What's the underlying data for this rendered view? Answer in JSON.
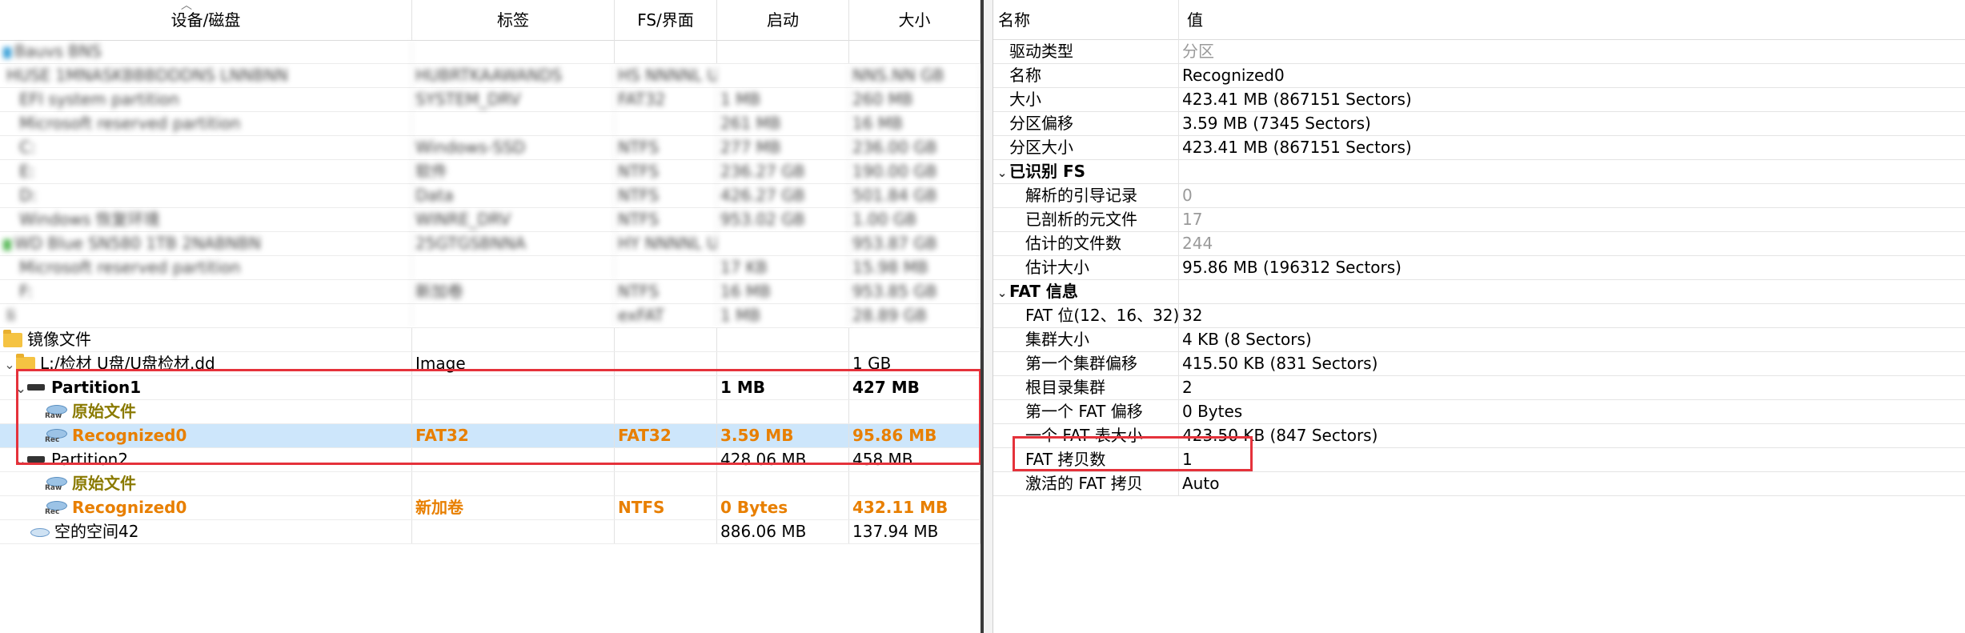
{
  "left": {
    "columns": [
      "设备/磁盘",
      "标签",
      "FS/界面",
      "启动",
      "大小"
    ],
    "blurred_rows": [
      [
        "Bauvs BNS",
        "",
        "",
        "",
        ""
      ],
      [
        "HUSE 1MNASKBBBDDDNS LNNBNN",
        "HUBRTKAAWANDS",
        "HS NNNNL UGB",
        "",
        "NNS.NN GB"
      ],
      [
        "EFI system partition",
        "SYSTEM_DRV",
        "FAT32",
        "1 MB",
        "260 MB"
      ],
      [
        "Microsoft reserved partition",
        "",
        "",
        "261 MB",
        "16 MB"
      ],
      [
        "C:",
        "Windows-SSD",
        "NTFS",
        "277 MB",
        "236.00 GB"
      ],
      [
        "E:",
        "软件",
        "NTFS",
        "236.27 GB",
        "190.00 GB"
      ],
      [
        "D:",
        "Data",
        "NTFS",
        "426.27 GB",
        "501.84 GB"
      ],
      [
        "Windows 恢复环境",
        "WINRE_DRV",
        "NTFS",
        "953.02 GB",
        "1.00 GB"
      ],
      [
        "WD Blue SN580 1TB 2NABNBN",
        "25GTGSBNNA",
        "HY NNNNL UGB",
        "",
        "953.87 GB"
      ],
      [
        "Microsoft reserved partition",
        "",
        "",
        "17 KB",
        "15.98 MB"
      ],
      [
        "F:",
        "新加卷",
        "NTFS",
        "16 MB",
        "953.85 GB"
      ],
      [
        "Ii",
        "",
        "exFAT",
        "1 MB",
        "28.89 GB"
      ]
    ],
    "image_group": {
      "label": "镜像文件",
      "file": {
        "name": "L:/检材 U盘/U盘检材.dd",
        "label": "Image",
        "size": "1 GB"
      },
      "partition1": {
        "name": "Partition1",
        "start": "1 MB",
        "size": "427 MB"
      },
      "p1_raw": {
        "name": "原始文件",
        "icon_tag": "Raw"
      },
      "p1_rec": {
        "name": "Recognized0",
        "label": "FAT32",
        "fs": "FAT32",
        "start": "3.59 MB",
        "size": "95.86 MB",
        "icon_tag": "Rec"
      },
      "partition2": {
        "name": "Partition2",
        "start": "428.06 MB",
        "size": "458 MB"
      },
      "p2_raw": {
        "name": "原始文件",
        "icon_tag": "Raw"
      },
      "p2_rec": {
        "name": "Recognized0",
        "label": "新加卷",
        "fs": "NTFS",
        "start": "0 Bytes",
        "size": "432.11 MB",
        "icon_tag": "Rec"
      },
      "free": {
        "name": "空的空间42",
        "start": "886.06 MB",
        "size": "137.94 MB"
      }
    }
  },
  "right": {
    "columns": [
      "名称",
      "值"
    ],
    "rows": [
      {
        "name": "驱动类型",
        "value": "分区",
        "grey": true
      },
      {
        "name": "名称",
        "value": "Recognized0"
      },
      {
        "name": "大小",
        "value": "423.41 MB (867151 Sectors)"
      },
      {
        "name": "分区偏移",
        "value": "3.59 MB (7345 Sectors)"
      },
      {
        "name": "分区大小",
        "value": "423.41 MB (867151 Sectors)"
      }
    ],
    "group1": {
      "title": "已识别 FS",
      "rows": [
        {
          "name": "解析的引导记录",
          "value": "0",
          "grey": true
        },
        {
          "name": "已剖析的元文件",
          "value": "17",
          "grey": true
        },
        {
          "name": "估计的文件数",
          "value": "244",
          "grey": true
        },
        {
          "name": "估计大小",
          "value": "95.86 MB (196312 Sectors)"
        }
      ]
    },
    "group2": {
      "title": "FAT 信息",
      "rows": [
        {
          "name": "FAT 位(12、16、32)",
          "value": "32"
        },
        {
          "name": "集群大小",
          "value": "4 KB (8 Sectors)"
        },
        {
          "name": "第一个集群偏移",
          "value": "415.50 KB (831 Sectors)"
        },
        {
          "name": "根目录集群",
          "value": "2"
        },
        {
          "name": "第一个 FAT 偏移",
          "value": "0 Bytes"
        },
        {
          "name": "一个 FAT 表大小",
          "value": "423.50 KB (847 Sectors)"
        },
        {
          "name": "FAT 拷贝数",
          "value": "1"
        },
        {
          "name": "激活的 FAT 拷贝",
          "value": "Auto"
        }
      ]
    }
  },
  "colors": {
    "highlight_box": "#e5323b",
    "accent_orange": "#e87f00",
    "selection": "#cde6fb",
    "raw_label": "#8a7a00"
  }
}
